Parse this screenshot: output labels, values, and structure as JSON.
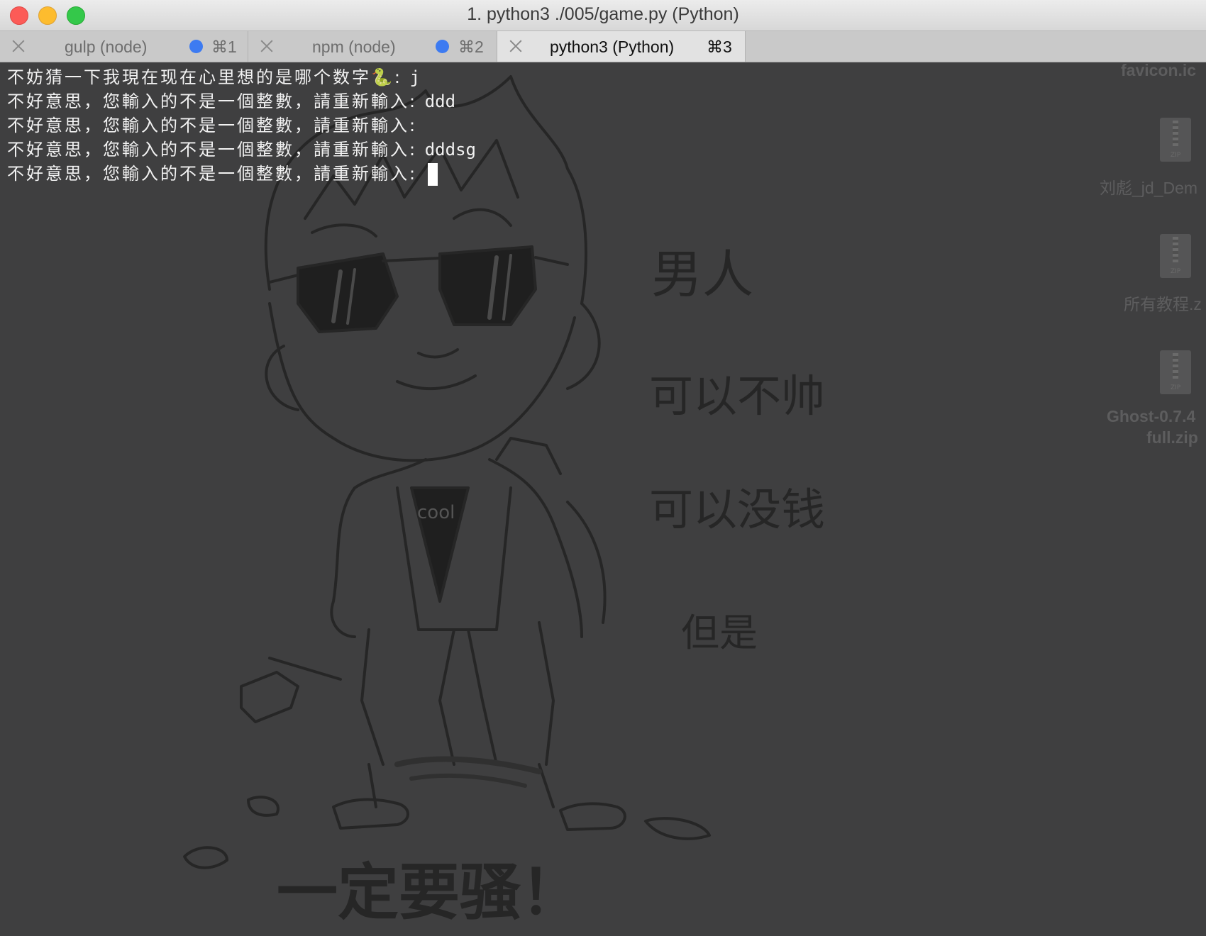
{
  "window": {
    "title": "1. python3 ./005/game.py (Python)"
  },
  "tabs": [
    {
      "label": "gulp (node)",
      "key": "⌘1",
      "active": false,
      "has_dot": true
    },
    {
      "label": "npm (node)",
      "key": "⌘2",
      "active": false,
      "has_dot": true
    },
    {
      "label": "python3 (Python)",
      "key": "⌘3",
      "active": true,
      "has_dot": false
    }
  ],
  "terminal": {
    "lines": [
      {
        "prompt": "不妨猜一下我現在现在心里想的是哪个数字",
        "emoji": "🐍",
        "sep": ": ",
        "input": "j"
      },
      {
        "prompt": "不好意思，您輸入的不是一個整數，請重新輸入",
        "sep": ": ",
        "input": "ddd"
      },
      {
        "prompt": "不好意思，您輸入的不是一個整數，請重新輸入",
        "sep": ": ",
        "input": ""
      },
      {
        "prompt": "不好意思，您輸入的不是一個整數，請重新輸入",
        "sep": ": ",
        "input": "dddsg"
      },
      {
        "prompt": "不好意思，您輸入的不是一個整數，請重新輸入",
        "sep": ": ",
        "input": ""
      }
    ]
  },
  "desktop_icons": [
    {
      "label": "favicon.ic",
      "icon": "image-file-icon"
    },
    {
      "label": "刘彪_jd_Dem",
      "icon": "zip-file-icon"
    },
    {
      "label": "所有教程.z",
      "icon": "zip-file-icon"
    },
    {
      "label": "Ghost-0.7.4",
      "label2": "full.zip",
      "icon": "zip-file-icon"
    }
  ],
  "wallpaper_text": {
    "line1": "男人",
    "line2": "可以不帅",
    "line3": "可以没钱",
    "line4": "但是",
    "line5": "一定要骚！",
    "shirt": "cool"
  },
  "colors": {
    "terminal_bg": "#3f3f40",
    "text": "#f2f2f2",
    "tab_dot": "#3d7bf1",
    "close": "#fc5b57",
    "minimize": "#fdbc2e",
    "maximize": "#34c84a"
  }
}
